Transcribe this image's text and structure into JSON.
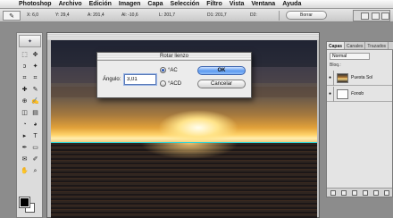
{
  "menubar": {
    "apple_glyph": "",
    "items": [
      "Photoshop",
      "Archivo",
      "Edición",
      "Imagen",
      "Capa",
      "Selección",
      "Filtro",
      "Vista",
      "Ventana",
      "Ayuda"
    ]
  },
  "options_bar": {
    "x_label": "X:",
    "x_value": "6,0",
    "y_label": "Y:",
    "y_value": "29,4",
    "a_label": "A:",
    "a_value": "201,4",
    "al_label": "Al:",
    "al_value": "-10,6",
    "l_label": "L:",
    "l_value": "201,7",
    "d1_label": "D1:",
    "d1_value": "201,7",
    "d2_label": "D2:",
    "d2_value": "",
    "borrar_label": "Borrar"
  },
  "dialog": {
    "title": "Rotar lienzo",
    "angle_label": "Ángulo:",
    "angle_value": "3,01",
    "radio_cw_label": "°AC",
    "radio_ccw_label": "°ACD",
    "ok_label": "OK",
    "cancel_label": "Cancelar"
  },
  "layers_palette": {
    "tabs": [
      "Capas",
      "Canales",
      "Trazados"
    ],
    "blend_mode": "Normal",
    "lock_label": "Bloq.:",
    "layers": [
      {
        "name": "Puesta Sol",
        "visible": true,
        "selected": false
      },
      {
        "name": "Fondo",
        "visible": true,
        "selected": false
      }
    ]
  },
  "toolbox": {
    "tools": [
      "marquee-tool",
      "move-tool",
      "lasso-tool",
      "magic-wand-tool",
      "crop-tool",
      "slice-tool",
      "healing-tool",
      "brush-tool",
      "clone-tool",
      "history-brush-tool",
      "eraser-tool",
      "gradient-tool",
      "blur-tool",
      "dodge-tool",
      "path-select-tool",
      "type-tool",
      "pen-tool",
      "shape-tool",
      "notes-tool",
      "eyedropper-tool",
      "hand-tool",
      "zoom-tool"
    ],
    "glyphs": [
      "⬚",
      "✥",
      "ↄ",
      "✦",
      "⌗",
      "⌗",
      "✚",
      "✎",
      "⊕",
      "✍",
      "◫",
      "▤",
      "◔",
      "◕",
      "▸",
      "T",
      "✒",
      "▭",
      "✉",
      "✐",
      "✋",
      "⌕"
    ]
  },
  "colors": {
    "foreground": "#000000",
    "background": "#ffffff",
    "guide_line": "#32d6d6",
    "selection_blue": "#5c9af0"
  }
}
